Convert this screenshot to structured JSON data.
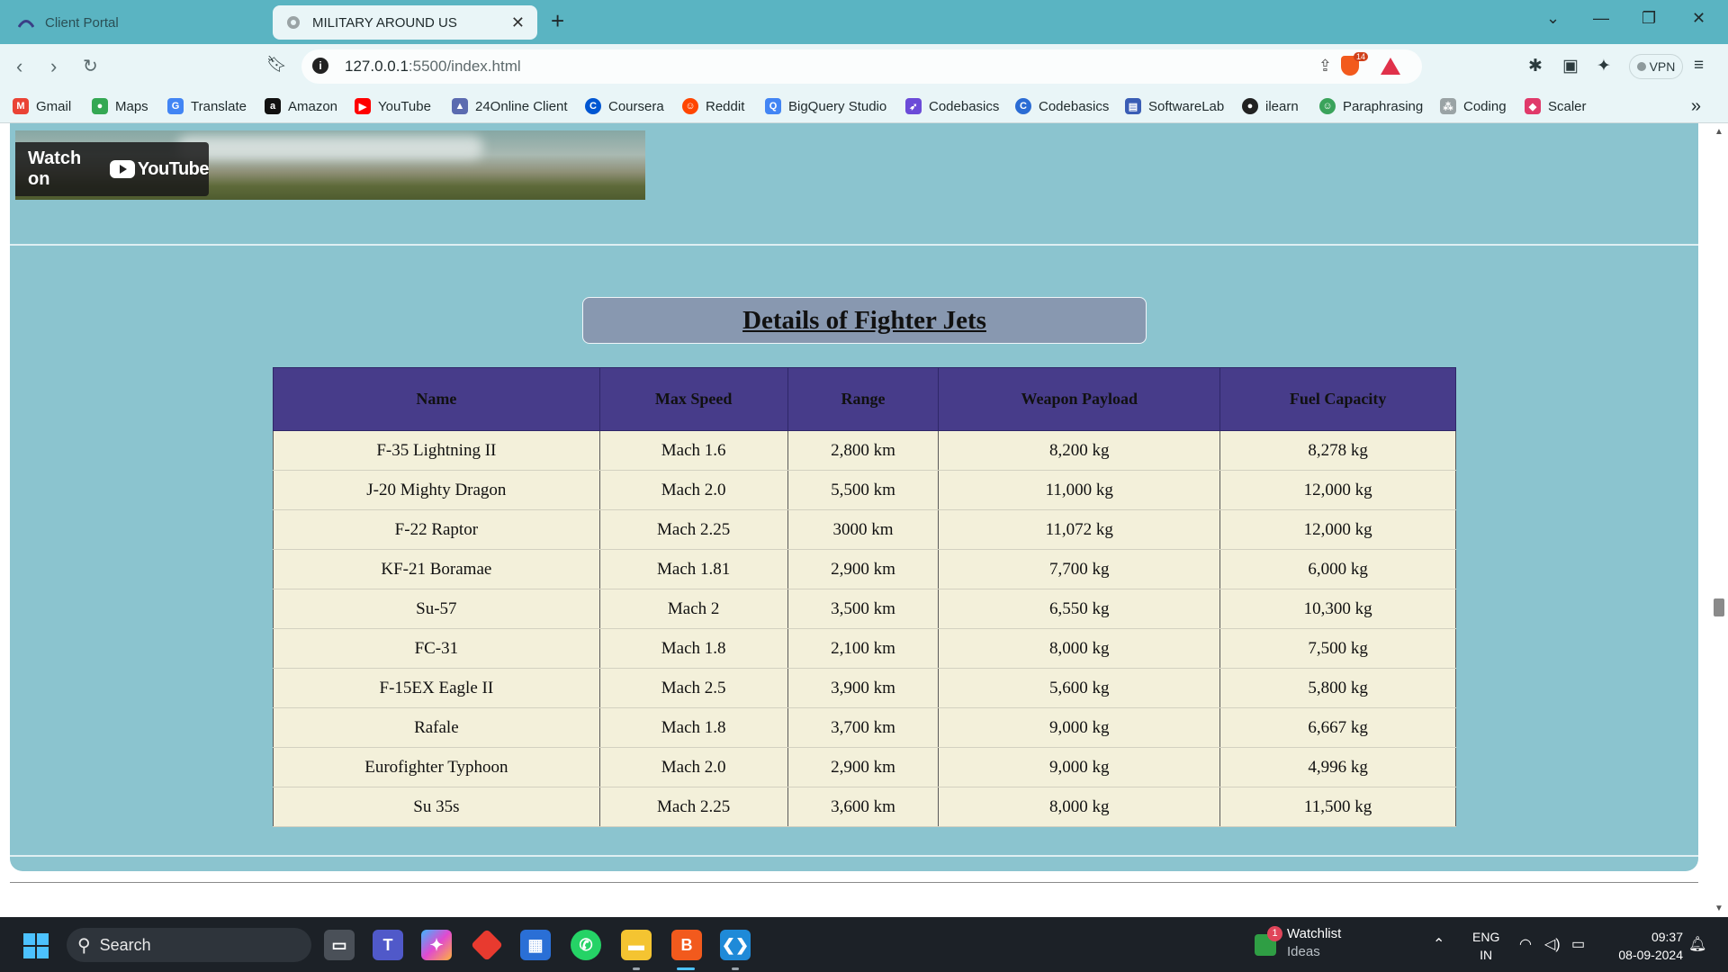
{
  "browser": {
    "tabs": [
      {
        "label": "Client Portal",
        "active": false
      },
      {
        "label": "MILITARY AROUND US",
        "active": true
      }
    ],
    "url_host": "127.0.0.1",
    "url_rest": ":5500/index.html",
    "brave_badge": "14",
    "vpn_label": "VPN"
  },
  "bookmarks": [
    {
      "label": "Gmail",
      "icon": "gmail-icon",
      "color": "#ea4335",
      "glyph": "M"
    },
    {
      "label": "Maps",
      "icon": "maps-icon",
      "color": "#34a853",
      "glyph": "●"
    },
    {
      "label": "Translate",
      "icon": "translate-icon",
      "color": "#4285f4",
      "glyph": "G"
    },
    {
      "label": "Amazon",
      "icon": "amazon-icon",
      "color": "#111111",
      "glyph": "a"
    },
    {
      "label": "YouTube",
      "icon": "youtube-icon",
      "color": "#ff0000",
      "glyph": "▶"
    },
    {
      "label": "24Online Client",
      "icon": "24online-icon",
      "color": "#5b6bb0",
      "glyph": "▲"
    },
    {
      "label": "Coursera",
      "icon": "coursera-icon",
      "color": "#0056d2",
      "glyph": "C"
    },
    {
      "label": "Reddit",
      "icon": "reddit-icon",
      "color": "#ff4500",
      "glyph": "☺"
    },
    {
      "label": "BigQuery Studio",
      "icon": "bigquery-icon",
      "color": "#4285f4",
      "glyph": "Q"
    },
    {
      "label": "Codebasics",
      "icon": "rocket-icon",
      "color": "#6b4bd8",
      "glyph": "➶"
    },
    {
      "label": "Codebasics",
      "icon": "codebasics-icon",
      "color": "#2b6cd4",
      "glyph": "C"
    },
    {
      "label": "SoftwareLab",
      "icon": "softwarelab-icon",
      "color": "#3a5db5",
      "glyph": "▤"
    },
    {
      "label": "ilearn",
      "icon": "ilearn-icon",
      "color": "#222222",
      "glyph": "●"
    },
    {
      "label": "Paraphrasing",
      "icon": "paraphrasing-icon",
      "color": "#3aa35b",
      "glyph": "☺"
    },
    {
      "label": "Coding",
      "icon": "coding-icon",
      "color": "#9aa3a5",
      "glyph": "⁂"
    },
    {
      "label": "Scaler",
      "icon": "scaler-icon",
      "color": "#e03a6a",
      "glyph": "◆"
    }
  ],
  "video": {
    "watch_on": "Watch on",
    "brand": "YouTube"
  },
  "section": {
    "title": "Details of Fighter Jets"
  },
  "table": {
    "headers": [
      "Name",
      "Max Speed",
      "Range",
      "Weapon Payload",
      "Fuel Capacity"
    ],
    "rows": [
      [
        "F-35 Lightning II",
        "Mach 1.6",
        "2,800 km",
        "8,200 kg",
        "8,278 kg"
      ],
      [
        "J-20 Mighty Dragon",
        "Mach 2.0",
        "5,500 km",
        "11,000 kg",
        "12,000 kg"
      ],
      [
        "F-22 Raptor",
        "Mach 2.25",
        "3000 km",
        "11,072 kg",
        "12,000 kg"
      ],
      [
        "KF-21 Boramae",
        "Mach 1.81",
        "2,900 km",
        "7,700 kg",
        "6,000 kg"
      ],
      [
        "Su-57",
        "Mach 2",
        "3,500 km",
        "6,550 kg",
        "10,300 kg"
      ],
      [
        "FC-31",
        "Mach 1.8",
        "2,100 km",
        "8,000 kg",
        "7,500 kg"
      ],
      [
        "F-15EX Eagle II",
        "Mach 2.5",
        "3,900 km",
        "5,600 kg",
        "5,800 kg"
      ],
      [
        "Rafale",
        "Mach 1.8",
        "3,700 km",
        "9,000 kg",
        "6,667 kg"
      ],
      [
        "Eurofighter Typhoon",
        "Mach 2.0",
        "2,900 km",
        "9,000 kg",
        "4,996 kg"
      ],
      [
        "Su 35s",
        "Mach 2.25",
        "3,600 km",
        "8,000 kg",
        "11,500 kg"
      ]
    ]
  },
  "taskbar": {
    "search_label": "Search",
    "watchlist_badge": "1",
    "watchlist_title": "Watchlist",
    "watchlist_sub": "Ideas",
    "lang_top": "ENG",
    "lang_bottom": "IN",
    "time": "09:37",
    "date": "08-09-2024"
  }
}
